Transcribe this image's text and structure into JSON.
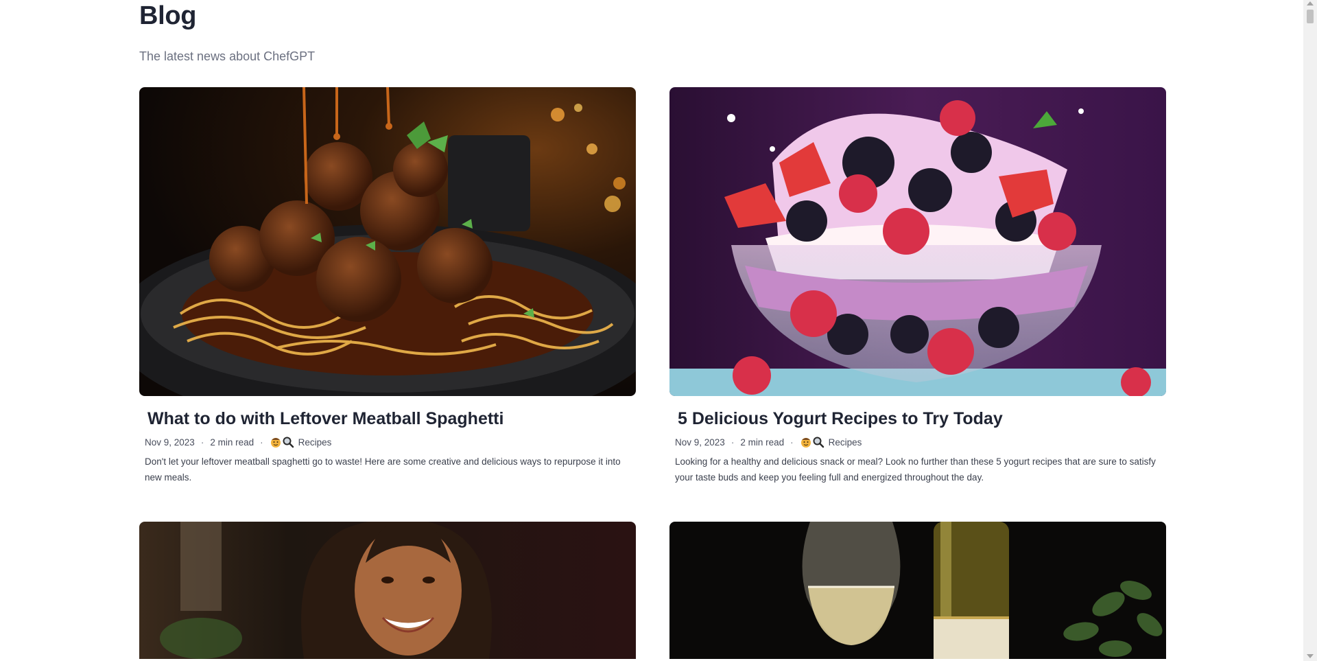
{
  "header": {
    "title": "Blog",
    "subtitle": "The latest news about ChefGPT"
  },
  "posts": [
    {
      "title": "What to do with Leftover Meatball Spaghetti",
      "date": "Nov 9, 2023",
      "read_time": "2 min read",
      "category": "Recipes",
      "excerpt": "Don't let your leftover meatball spaghetti go to waste! Here are some creative and delicious ways to repurpose it into new meals.",
      "image": "meatball-spaghetti-photo"
    },
    {
      "title": "5 Delicious Yogurt Recipes to Try Today",
      "date": "Nov 9, 2023",
      "read_time": "2 min read",
      "category": "Recipes",
      "excerpt": "Looking for a healthy and delicious snack or meal? Look no further than these 5 yogurt recipes that are sure to satisfy your taste buds and keep you feeling full and energized throughout the day.",
      "image": "yogurt-berries-photo"
    },
    {
      "image": "smiling-woman-photo"
    },
    {
      "image": "white-wine-photo"
    }
  ],
  "separator": "·",
  "icons": {
    "author": "chef-icon",
    "search": "search-icon"
  },
  "colors": {
    "text": "#1f2433",
    "muted": "#6b7080",
    "background": "#ffffff"
  }
}
